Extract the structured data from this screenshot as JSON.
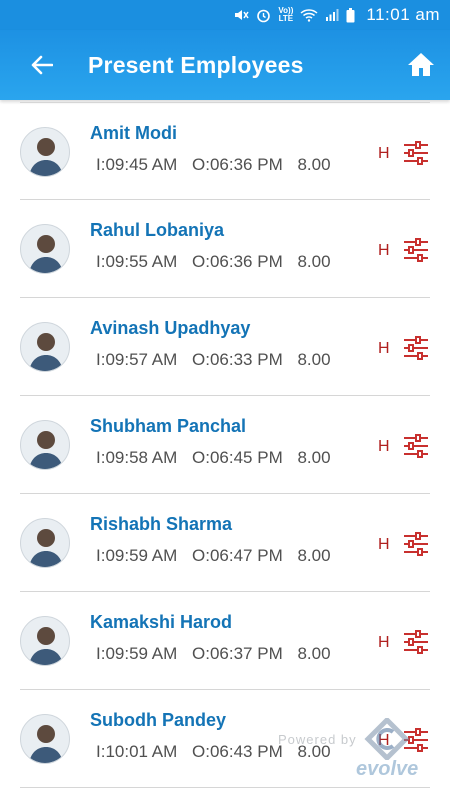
{
  "status_bar": {
    "volte_label": "Vo))\nLTE",
    "time": "11:01 am"
  },
  "app_bar": {
    "title": "Present Employees"
  },
  "employees": [
    {
      "name": "Amit Modi",
      "in_time": "I:09:45 AM",
      "out_time": "O:06:36 PM",
      "hours": "8.00",
      "tag": "H"
    },
    {
      "name": "Rahul Lobaniya",
      "in_time": "I:09:55 AM",
      "out_time": "O:06:36 PM",
      "hours": "8.00",
      "tag": "H"
    },
    {
      "name": "Avinash Upadhyay",
      "in_time": "I:09:57 AM",
      "out_time": "O:06:33 PM",
      "hours": "8.00",
      "tag": "H"
    },
    {
      "name": "Shubham Panchal",
      "in_time": "I:09:58 AM",
      "out_time": "O:06:45 PM",
      "hours": "8.00",
      "tag": "H"
    },
    {
      "name": "Rishabh Sharma",
      "in_time": "I:09:59 AM",
      "out_time": "O:06:47 PM",
      "hours": "8.00",
      "tag": "H"
    },
    {
      "name": "Kamakshi Harod",
      "in_time": "I:09:59 AM",
      "out_time": "O:06:37 PM",
      "hours": "8.00",
      "tag": "H"
    },
    {
      "name": "Subodh Pandey",
      "in_time": "I:10:01 AM",
      "out_time": "O:06:43 PM",
      "hours": "8.00",
      "tag": "H"
    }
  ],
  "watermark": {
    "powered_by": "Powered by",
    "brand": "evolve"
  },
  "colors": {
    "app_bar": "#1d91e3",
    "name_text": "#1474b6",
    "tag_red": "#b0201f"
  }
}
